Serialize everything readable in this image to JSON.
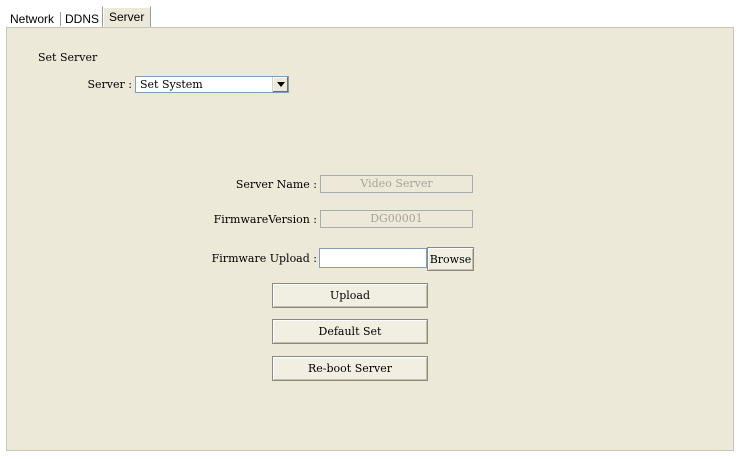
{
  "tabs": [
    {
      "label": "Network",
      "active": false
    },
    {
      "label": "DDNS",
      "active": false
    },
    {
      "label": "Server",
      "active": true
    }
  ],
  "section": {
    "title": "Set Server"
  },
  "server_select": {
    "label": "Server :",
    "value": "Set System"
  },
  "fields": {
    "server_name": {
      "label": "Server Name :",
      "value": "Video Server"
    },
    "firmware_version": {
      "label": "FirmwareVersion :",
      "value": "DG00001"
    },
    "firmware_upload": {
      "label": "Firmware Upload :",
      "value": "",
      "browse_label": "Browse"
    }
  },
  "buttons": {
    "upload": "Upload",
    "default_set": "Default Set",
    "reboot": "Re-boot Server"
  },
  "colors": {
    "panel_bg": "#ece9d8",
    "border": "#7f9db9"
  }
}
